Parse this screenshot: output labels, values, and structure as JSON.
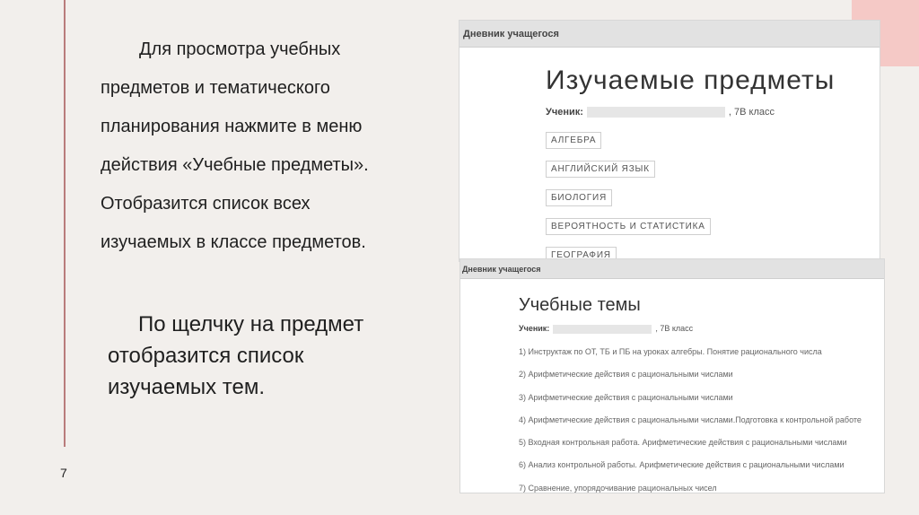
{
  "slide": {
    "page_number": "7",
    "para1_lines": [
      "Для просмотра учебных",
      "предметов и тематического",
      "планирования нажмите в меню",
      "действия «Учебные предметы».",
      "Отобразится список всех",
      "изучаемых в классе предметов."
    ],
    "para2_lines": [
      "По щелчку на предмет",
      "отобразится список",
      "изучаемых тем."
    ],
    "accent_color": "#b97c7c",
    "corner_color": "#f5c9c6"
  },
  "screenshot1": {
    "header": "Дневник учащегося",
    "title": "Изучаемые предметы",
    "student_label": "Ученик:",
    "class_text": ", 7В класс",
    "subjects": [
      "АЛГЕБРА",
      "АНГЛИЙСКИЙ ЯЗЫК",
      "БИОЛОГИЯ",
      "ВЕРОЯТНОСТЬ И СТАТИСТИКА",
      "ГЕОГРАФИЯ"
    ]
  },
  "screenshot2": {
    "header": "Дневник учащегося",
    "title": "Учебные темы",
    "student_label": "Ученик:",
    "class_text": ", 7В класс",
    "topics": [
      "1) Инструктаж по ОТ, ТБ и ПБ на уроках алгебры. Понятие рационального числа",
      "2) Арифметические действия с рациональными числами",
      "3) Арифметические действия с рациональными числами",
      "4) Арифметические действия с рациональными числами.Подготовка к контрольной работе",
      "5) Входная контрольная работа. Арифметические действия с рациональными числами",
      "6) Анализ контрольной работы. Арифметические действия с рациональными числами",
      "7) Сравнение, упорядочивание рациональных чисел"
    ]
  }
}
